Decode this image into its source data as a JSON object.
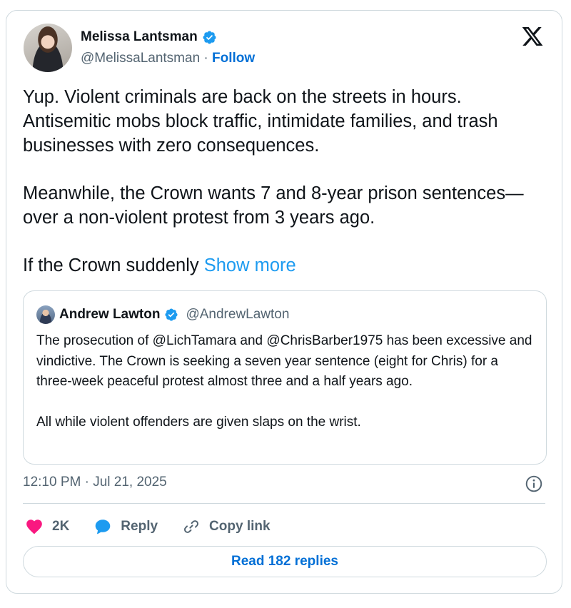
{
  "author": {
    "name": "Melissa Lantsman",
    "handle": "@MelissaLantsman",
    "separator": " · ",
    "follow_label": "Follow"
  },
  "tweet": {
    "para1": "Yup. Violent criminals are back on the streets in hours. Antisemitic mobs block traffic, intimidate families, and trash businesses with zero consequences.",
    "para2": "Meanwhile, the Crown wants 7 and 8-year prison sentences—over a non-violent protest from 3 years ago.",
    "para3": "If the Crown suddenly ",
    "show_more": "Show more"
  },
  "quote": {
    "name": "Andrew Lawton",
    "handle": "@AndrewLawton",
    "para1": "The prosecution of @LichTamara and @ChrisBarber1975 has been excessive and vindictive. The Crown is seeking a seven year sentence (eight for Chris) for a three-week peaceful protest almost three and a half years ago.",
    "para2": "All while violent offenders are given slaps on the wrist."
  },
  "meta": {
    "timestamp": "12:10 PM · Jul 21, 2025"
  },
  "actions": {
    "likes": "2K",
    "reply_label": "Reply",
    "copy_label": "Copy link"
  },
  "read_replies_label": "Read 182 replies",
  "colors": {
    "link_blue": "#1d9bf0",
    "follow_blue": "#006fd6",
    "heart_pink": "#f91880",
    "verified_blue": "#1d9bf0",
    "muted_text": "#536471",
    "border": "#cfd9de"
  },
  "icons": [
    "verified-badge-icon",
    "x-logo-icon",
    "info-icon",
    "heart-icon",
    "reply-bubble-icon",
    "link-icon"
  ]
}
